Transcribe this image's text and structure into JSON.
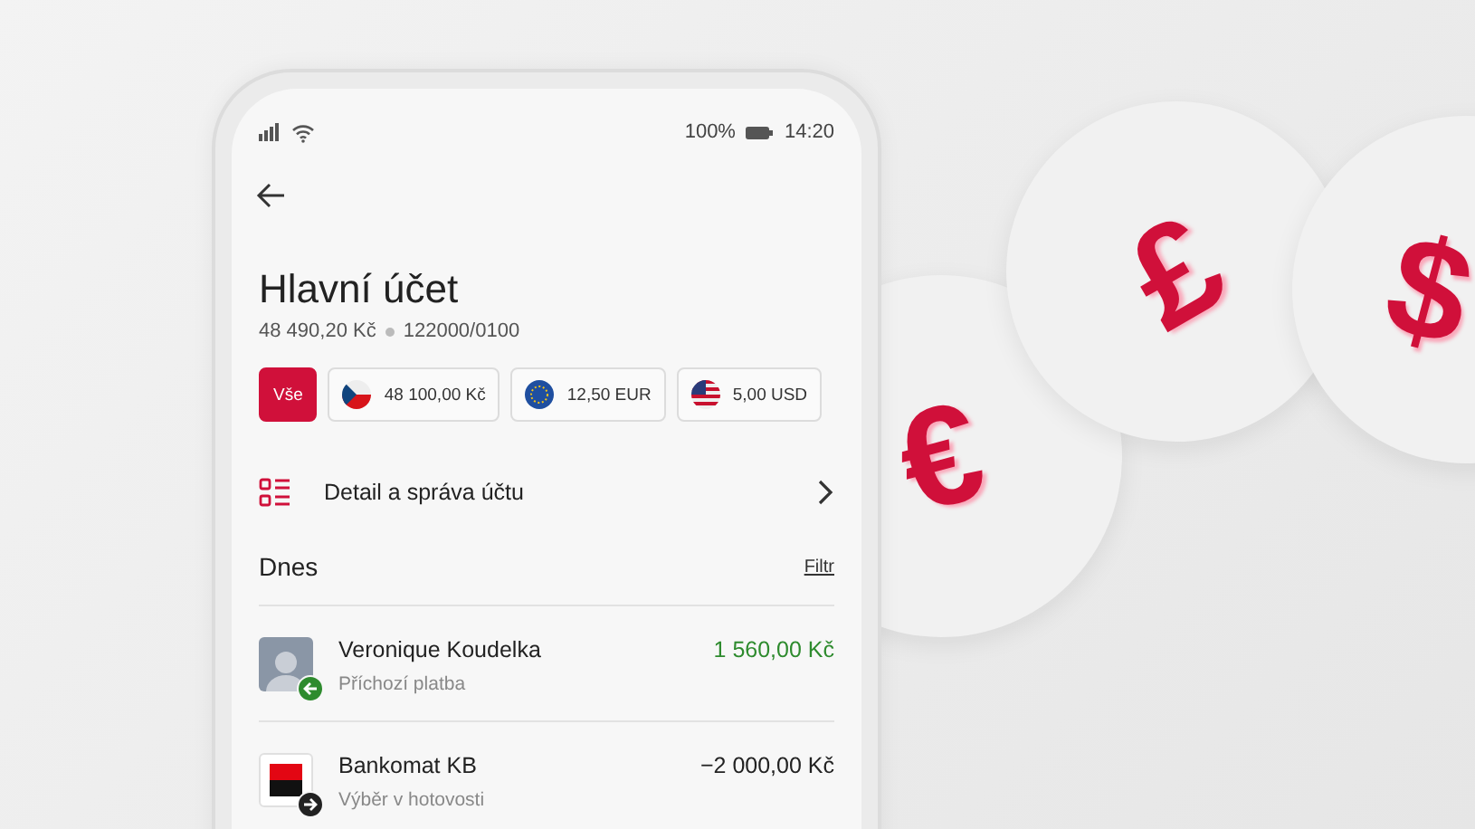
{
  "status_bar": {
    "battery": "100%",
    "time": "14:20"
  },
  "account": {
    "title": "Hlavní účet",
    "balance": "48 490,20 Kč",
    "number": "122000/0100"
  },
  "chips": [
    {
      "label": "Vše",
      "kind": "all",
      "selected": true
    },
    {
      "label": "48 100,00 Kč",
      "kind": "cz",
      "selected": false
    },
    {
      "label": "12,50 EUR",
      "kind": "eu",
      "selected": false
    },
    {
      "label": "5,00 USD",
      "kind": "us",
      "selected": false
    }
  ],
  "detail_link": "Detail a správa účtu",
  "section": {
    "title": "Dnes",
    "filter": "Filtr"
  },
  "transactions": [
    {
      "name": "Veronique Koudelka",
      "note": "Příchozí platba",
      "amount": "1 560,00 Kč",
      "kind": "incoming",
      "photo": true
    },
    {
      "name": "Bankomat KB",
      "note": "Výběr v hotovosti",
      "amount": "−2 000,00 Kč",
      "kind": "outgoing",
      "photo": false
    }
  ],
  "coins": [
    {
      "symbol": "€"
    },
    {
      "symbol": "£"
    },
    {
      "symbol": "$"
    }
  ]
}
